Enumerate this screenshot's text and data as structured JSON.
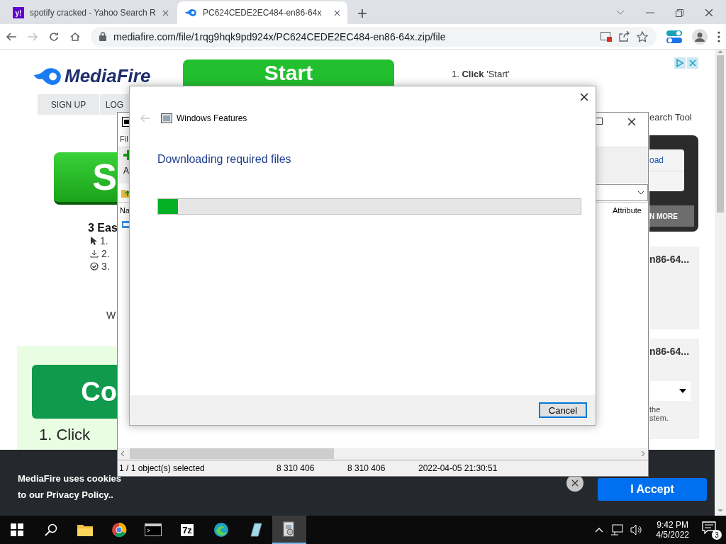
{
  "browser": {
    "tabs": [
      {
        "favicon": "y!",
        "title": "spotify cracked - Yahoo Search R",
        "selected": false
      },
      {
        "title": "PC624CEDE2EC484-en86-64x",
        "selected": true
      }
    ],
    "navigation": [
      {
        "kind": "back",
        "disabled": false
      },
      {
        "kind": "forward",
        "disabled": true
      },
      {
        "kind": "reload",
        "disabled": false
      },
      {
        "kind": "home",
        "disabled": false
      }
    ],
    "address": "mediafire.com/file/1rqg9hqk9pd924x/PC624CEDE2EC484-en86-64x.zip/file"
  },
  "page": {
    "logo": "MediaFire",
    "start_button": "Start",
    "nav": [
      "SIGN UP",
      "LOG"
    ],
    "download_button": "S",
    "steps_title": "3 Eas",
    "steps": [
      {
        "kind": "cursor",
        "text": "1."
      },
      {
        "kind": "download",
        "text": "2."
      },
      {
        "kind": "check",
        "text": "3."
      }
    ],
    "note": "W",
    "continue_button": "Co",
    "instruction": "1. Click",
    "right_intro": "1. **Click** 'Start'",
    "side_label": "earch Tool",
    "ad": {
      "link": "oad",
      "button": "N MORE"
    },
    "file_cards": [
      {
        "kind": "plain",
        "title": "n86-64..."
      },
      {
        "kind": "dropdown",
        "title": "n86-64...",
        "lines": [
          "the",
          "stem."
        ]
      }
    ]
  },
  "cookie_banner": {
    "lines": [
      "MediaFire uses cookies",
      "to our Privacy Policy.."
    ],
    "accept": "I Accept"
  },
  "archive_window": {
    "menu": "Fil",
    "toolbar_label": "A",
    "columns": [
      "Na",
      "Attribute"
    ],
    "status_bar": [
      "1 / 1 object(s) selected",
      "8 310 406",
      "8 310 406",
      "2022-04-05 21:30:51"
    ]
  },
  "dialog": {
    "title": "Windows Features",
    "back_disabled": true,
    "heading": "Downloading required files",
    "progress": {
      "level": 0.047
    },
    "button": "Cancel"
  },
  "taskbar": {
    "apps": [
      {
        "kind": "explorer",
        "selected": false
      },
      {
        "kind": "chrome",
        "selected": false
      },
      {
        "kind": "terminal",
        "selected": false
      },
      {
        "kind": "sevenzip",
        "label": "7z",
        "selected": false
      },
      {
        "kind": "edge",
        "selected": false
      },
      {
        "kind": "notepad",
        "selected": false
      },
      {
        "kind": "installer",
        "selected": true
      }
    ],
    "time": "9:42 PM",
    "date": "4/5/2022",
    "notifications": "3"
  }
}
